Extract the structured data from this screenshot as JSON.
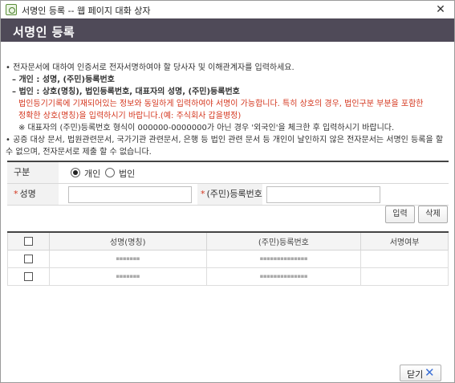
{
  "window": {
    "title": "서명인 등록 -- 웹 페이지 대화 상자",
    "close_glyph": "✕"
  },
  "header": {
    "title": "서명인 등록"
  },
  "instructions": {
    "l1": "• 전자문서에 대하여 인증서로 전자서명하여야 할 당사자 및 이해관계자를 입력하세요.",
    "l2": "– 개인 : 성명, (주민)등록번호",
    "l3": "– 법인 : 상호(명칭), 법인등록번호, 대표자의 성명, (주민)등록번호",
    "l4": "법인등기기록에 기재되어있는 정보와 동일하게 입력하여야 서명이 가능합니다. 특히 상호의 경우, 법인구분 부분을 포함한",
    "l5": "정확한 상호(명칭)을 입력하시기 바랍니다.(예: 주식회사 갑을병정)",
    "l6": "※ 대표자의 (주민)등록번호 형식이 000000-0000000가 아닌 경우 '외국인'을 체크한 후 입력하시기 바랍니다.",
    "l7": "• 공증 대상 문서, 법원관련문서, 국가기관 관련문서, 은행 등 법인 관련 문서 등 개인이 날인하지 않은 전자문서는 서명인 등록을 할 수 없으며, 전자문서로 제출 할 수 없습니다."
  },
  "form": {
    "type_label": "구분",
    "radio_individual": "개인",
    "radio_corporate": "법인",
    "selected": "개인",
    "required_mark": "*",
    "name_label": "성명",
    "name_value": "",
    "regno_label": "(주민)등록번호",
    "regno_value": ""
  },
  "actions": {
    "input_label": "입력",
    "delete_label": "삭제"
  },
  "grid": {
    "columns": [
      "성명(명칭)",
      "(주민)등록번호",
      "서명여부"
    ],
    "rows": [
      {
        "name": "▪▪▪▪▪▪▪",
        "regno": "▪▪▪▪▪▪▪▪▪▪▪▪▪▪",
        "signed": ""
      },
      {
        "name": "▪▪▪▪▪▪▪",
        "regno": "▪▪▪▪▪▪▪▪▪▪▪▪▪▪",
        "signed": ""
      }
    ]
  },
  "footer": {
    "close_label": "닫기",
    "close_glyph": "✕"
  }
}
